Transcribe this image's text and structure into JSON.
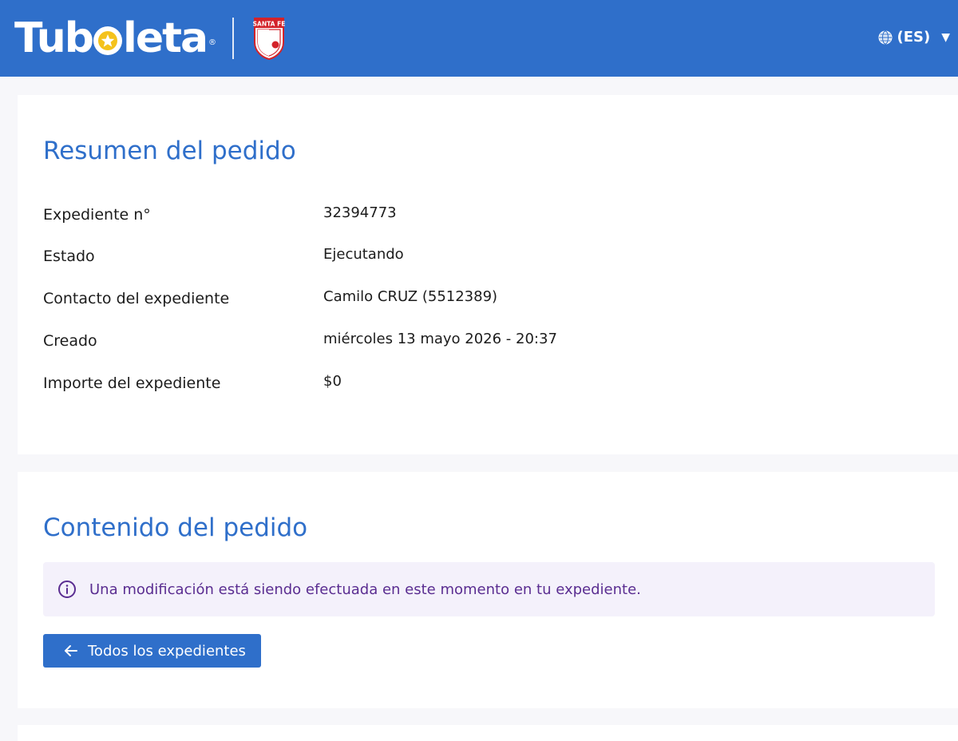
{
  "header": {
    "brand": {
      "part1": "Tub",
      "part2": "leta",
      "reg": "®"
    },
    "partner_logo_text": "SANTA FE",
    "language": {
      "label": "(ES)",
      "icon": "globe-icon",
      "dropdown_icon": "caret-down-icon"
    }
  },
  "summary": {
    "title": "Resumen del pedido",
    "rows": [
      {
        "label": "Expediente n°",
        "value": "32394773"
      },
      {
        "label": "Estado",
        "value": "Ejecutando"
      },
      {
        "label": "Contacto del expediente",
        "value": "Camilo CRUZ (5512389)"
      },
      {
        "label": "Creado",
        "value": "miércoles 13 mayo 2026 - 20:37"
      },
      {
        "label": "Importe del expediente",
        "value": "$0"
      }
    ]
  },
  "content": {
    "title": "Contenido del pedido",
    "notice": {
      "icon": "info-icon",
      "message": "Una modificación está siendo efectuada en este momento en tu expediente."
    },
    "back_button": {
      "icon": "arrow-left-icon",
      "label": "Todos los expedientes"
    }
  },
  "colors": {
    "brand_blue": "#2f6fca",
    "notice_bg": "#f4f1fb",
    "notice_text": "#5a2d91",
    "partner_red": "#d3232a",
    "star_yellow": "#f4c21c"
  }
}
